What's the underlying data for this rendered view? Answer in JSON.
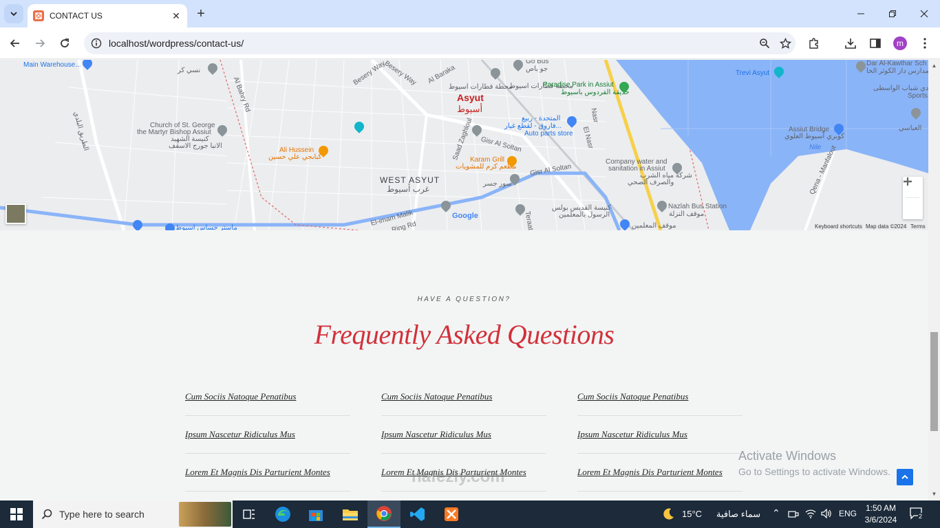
{
  "browser": {
    "tab_title": "CONTACT US",
    "url": "localhost/wordpress/contact-us/",
    "profile_initial": "m"
  },
  "map": {
    "labels": {
      "main_warehouse": "Main Warehouse...",
      "nasy_kor": "نسي كر",
      "al_bahry_rd": "Al Bahry Rd",
      "besery_way": "Besery Way",
      "al_baraka": "Al Baraka",
      "station_ar": "محطة قطارات اسيوط",
      "city_en": "Asyut",
      "city_ar": "أسيوط",
      "go_bus": "Go Bus",
      "go_bus_ar": "جو باص",
      "paradise_park": "Paradise Park in Assiut",
      "paradise_park_ar": "حديقة الفردوس باسيوط",
      "trevi_asyut": "Trevi Asyut",
      "dar_al_kawthar": "Dar Al-Kawthar Sch",
      "dar_al_kawthar_ar": "مدارس دار الكوثر الخا",
      "wasti_club": "نادي شباب الواسطى",
      "sports": "Sports C",
      "church": "Church of St. George",
      "church2": "the Martyr Bishop Assiut",
      "church_ar": "كنيسة الشهيد",
      "church_ar2": "الانبا جورج الاسقف",
      "al_talee": "الطريق البلدي",
      "ali_hussein": "Ali Hussein",
      "ali_hussein_ar": "كبابجي علي حسين",
      "saad_zaghloul": "Saad Zaghloul",
      "gisr_al_soltan": "Gisr Al Soltan",
      "karam_grill": "Karam Grill",
      "karam_grill_ar": "مطعم كرم للمشويات",
      "auto_parts": "المتحدة - ربيع",
      "auto_parts2": "فاروق - لقطع غيار...",
      "auto_parts3": "Auto parts store",
      "nasr": "Nasr",
      "el_nasr": "El Nasr",
      "company_water": "Company water and",
      "company_water2": "sanitation in Assiut",
      "company_water_ar": "شركة مياه الشرب",
      "company_water_ar2": "والصرف الصحي",
      "assiut_bridge": "Assiut Bridge",
      "assiut_bridge_ar": "كوبري أسيوط العلوي",
      "nile": "Nile",
      "qena_manfalout": "Qena - Manfalout",
      "elabaseya": "العباسي",
      "west_asyut": "WEST ASYUT",
      "west_asyut_ar": "غرب أسيوط",
      "sour_gisr": "سور جسر",
      "el_imam_malik": "El-imam Malik",
      "ring_rd": "Ring Rd",
      "gisr_al_soltan2": "Gisr Al Soltan",
      "church_paul": "كنيسة القديس بولس",
      "church_paul2": "الرسول بالمعلمين",
      "teraat": "Teraat Al...",
      "nazlah": "Nazlah Bus Station",
      "nazlah_ar": "موقف النزلة",
      "moalemeen": "موقف المعلمين",
      "bottom_left": "ماستر حساس اسيوط",
      "google": "Google"
    },
    "footer": {
      "shortcuts": "Keyboard shortcuts",
      "map_data": "Map data ©2024",
      "terms": "Terms"
    }
  },
  "faq": {
    "eyebrow": "HAVE A QUESTION?",
    "title": "Frequently Asked Questions",
    "columns": [
      [
        "Cum Sociis Natoque Penatibus",
        "Ipsum Nascetur Ridiculus Mus",
        "Lorem Et Magnis Dis Parturient Montes"
      ],
      [
        "Cum Sociis Natoque Penatibus",
        "Ipsum Nascetur Ridiculus Mus",
        "Lorem Et Magnis Dis Parturient Montes"
      ],
      [
        "Cum Sociis Natoque Penatibus",
        "Ipsum Nascetur Ridiculus Mus",
        "Lorem Et Magnis Dis Parturient Montes"
      ]
    ]
  },
  "activate_windows": {
    "line1": "Activate Windows",
    "line2": "Go to Settings to activate Windows."
  },
  "watermark": "nafezly.com",
  "taskbar": {
    "search_placeholder": "Type here to search",
    "weather_temp": "15°C",
    "weather_text": "سماء صافية",
    "language": "ENG",
    "time": "1:50 AM",
    "date": "3/6/2024",
    "notifications": "2"
  },
  "colors": {
    "accent_red": "#d2313a",
    "tab_strip": "#d3e3fd",
    "taskbar": "#1c2a3a",
    "water": "#8ab4f8"
  }
}
